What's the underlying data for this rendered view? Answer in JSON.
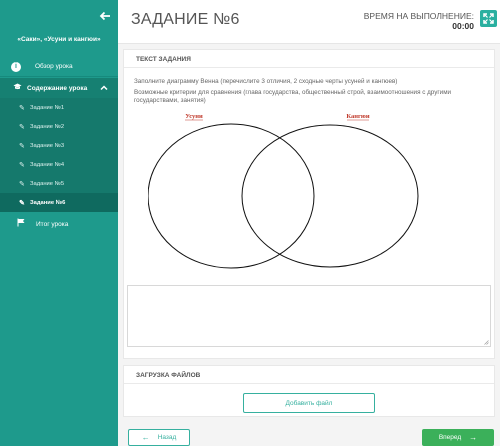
{
  "sidebar": {
    "course_title": "«Саки», «Усуни и кангюи»",
    "overview": {
      "label": "Обзор урока",
      "icon": "info-icon"
    },
    "contents": {
      "label": "Содержание урока",
      "icon": "graduation-cap-icon"
    },
    "tasks": [
      {
        "label": "Задание №1",
        "icon": "edit-icon"
      },
      {
        "label": "Задание №2",
        "icon": "edit-icon"
      },
      {
        "label": "Задание №3",
        "icon": "edit-icon"
      },
      {
        "label": "Задание №4",
        "icon": "edit-icon"
      },
      {
        "label": "Задание №5",
        "icon": "edit-icon"
      },
      {
        "label": "Задание №6",
        "icon": "edit-icon",
        "active": true
      }
    ],
    "result": {
      "label": "Итог урока",
      "icon": "flag-icon"
    }
  },
  "header": {
    "title": "ЗАДАНИЕ №6",
    "timer_label": "ВРЕМЯ НА ВЫПОЛНЕНИЕ:",
    "timer_value": "00:00"
  },
  "task": {
    "heading": "ТЕКСТ ЗАДАНИЯ",
    "instruction1": "Заполните диаграмму Венна (перечислите 3 отличия, 2 сходные черты усуней и кангюев)",
    "instruction2": "Возможные критерии для сравнения (глава государства, общественный строй, взаимоотношения с другими государствами, занятия)",
    "venn_left_label": "Усуни",
    "venn_right_label": "Кангюи",
    "answer_value": ""
  },
  "upload": {
    "heading": "ЗАГРУЗКА ФАЙЛОВ",
    "button": "Добавить файл"
  },
  "footer": {
    "back": "Назад",
    "next": "Вперед"
  },
  "colors": {
    "sidebar": "#1e9a8c",
    "accent": "#36b09f",
    "next_button": "#3bb05a",
    "venn_label": "#c0392b"
  }
}
